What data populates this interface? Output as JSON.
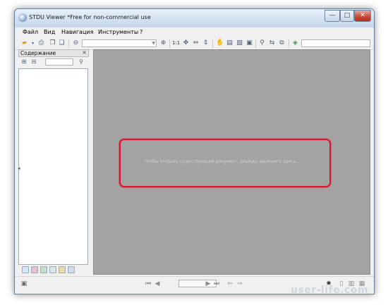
{
  "window": {
    "title": "STDU Viewer *Free for non-commercial use",
    "minimize": "—",
    "maximize": "□",
    "close": "✕"
  },
  "menu": [
    "Файл",
    "Вид",
    "Навигация",
    "Инструменты",
    "?"
  ],
  "toolbar": {
    "zoom_ratio": "1:1",
    "icons": [
      "open-folder-icon",
      "dropdown-arrow-icon",
      "print-icon",
      "copy-page-icon",
      "export-icon",
      "zoom-out-icon",
      "zoom-in-icon",
      "fit-page-icon",
      "fit-width-icon",
      "fit-height-icon",
      "hand-tool-icon",
      "select-text-icon",
      "select-image-icon",
      "snapshot-icon",
      "find-icon",
      "prev-result-icon",
      "next-result-icon",
      "web-icon"
    ]
  },
  "sidebar": {
    "title": "Содержание",
    "close": "×"
  },
  "main": {
    "hint": "Чтобы открыть существующий документ, дважды щелкните здесь..."
  },
  "colors": {
    "highlight_border": "#e0142a",
    "viewer_background": "#a3a3a3"
  },
  "watermark": "user-life.com"
}
